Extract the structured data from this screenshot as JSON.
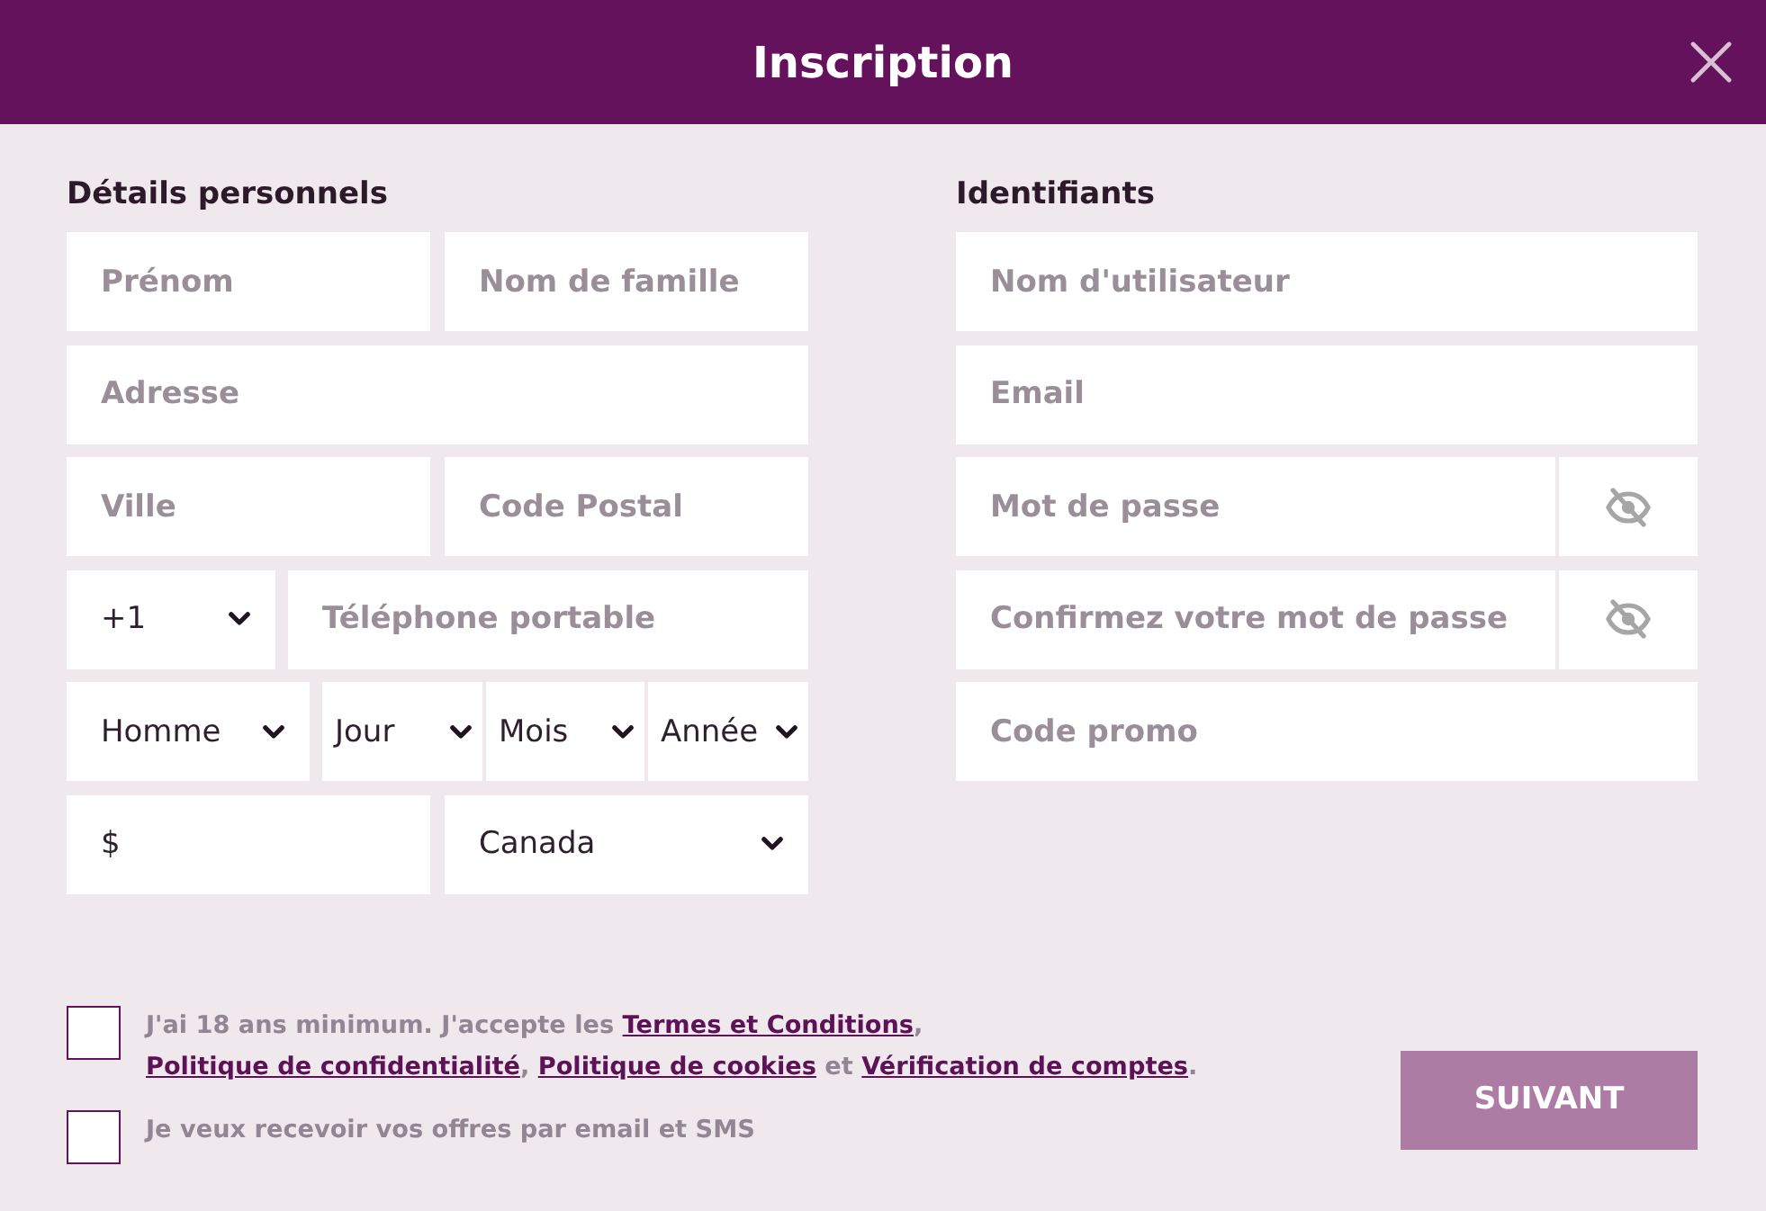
{
  "header": {
    "title": "Inscription"
  },
  "sections": [
    {
      "heading": "Détails personnels",
      "rows": [
        {
          "fields": [
            {
              "kind": "text",
              "placeholder": "Prénom"
            },
            {
              "kind": "text",
              "placeholder": "Nom de famille"
            }
          ]
        },
        {
          "fields": [
            {
              "kind": "text",
              "placeholder": "Adresse"
            }
          ]
        },
        {
          "fields": [
            {
              "kind": "text",
              "placeholder": "Ville"
            },
            {
              "kind": "text",
              "placeholder": "Code Postal"
            }
          ]
        },
        {
          "fields": [
            {
              "kind": "select",
              "value": "+1"
            },
            {
              "kind": "text",
              "placeholder": "Téléphone portable"
            }
          ]
        },
        {
          "fields": [
            {
              "kind": "select",
              "value": "Homme"
            },
            {
              "kind": "select",
              "value": "Jour"
            },
            {
              "kind": "select",
              "value": "Mois"
            },
            {
              "kind": "select",
              "value": "Année"
            }
          ]
        },
        {
          "fields": [
            {
              "kind": "amount",
              "value": "$"
            },
            {
              "kind": "select",
              "value": "Canada"
            }
          ]
        }
      ]
    },
    {
      "heading": "Identifiants",
      "rows": [
        {
          "fields": [
            {
              "kind": "text",
              "placeholder": "Nom d'utilisateur"
            }
          ]
        },
        {
          "fields": [
            {
              "kind": "text",
              "placeholder": "Email"
            }
          ]
        },
        {
          "fields": [
            {
              "kind": "password",
              "placeholder": "Mot de passe",
              "revealed": false
            }
          ]
        },
        {
          "fields": [
            {
              "kind": "password",
              "placeholder": "Confirmez votre mot de passe",
              "revealed": false
            }
          ]
        },
        {
          "fields": [
            {
              "kind": "text",
              "placeholder": "Code promo"
            }
          ]
        }
      ]
    }
  ],
  "consents": [
    {
      "checked": false,
      "segments": [
        {
          "kind": "text",
          "text": "J'ai 18 ans minimum. J'accepte les "
        },
        {
          "kind": "link",
          "text": "Termes et Conditions"
        },
        {
          "kind": "text",
          "text": ", "
        },
        {
          "kind": "link",
          "text": "Politique de confidentialité"
        },
        {
          "kind": "text",
          "text": ", "
        },
        {
          "kind": "link",
          "text": "Politique de cookies"
        },
        {
          "kind": "text",
          "text": " et "
        },
        {
          "kind": "link",
          "text": "Vérification de comptes"
        },
        {
          "kind": "text",
          "text": "."
        }
      ]
    },
    {
      "checked": false,
      "segments": [
        {
          "kind": "text",
          "text": "Je veux recevoir vos offres par email et SMS"
        }
      ]
    }
  ],
  "next_button": {
    "label": "SUIVANT",
    "disabled": true
  }
}
